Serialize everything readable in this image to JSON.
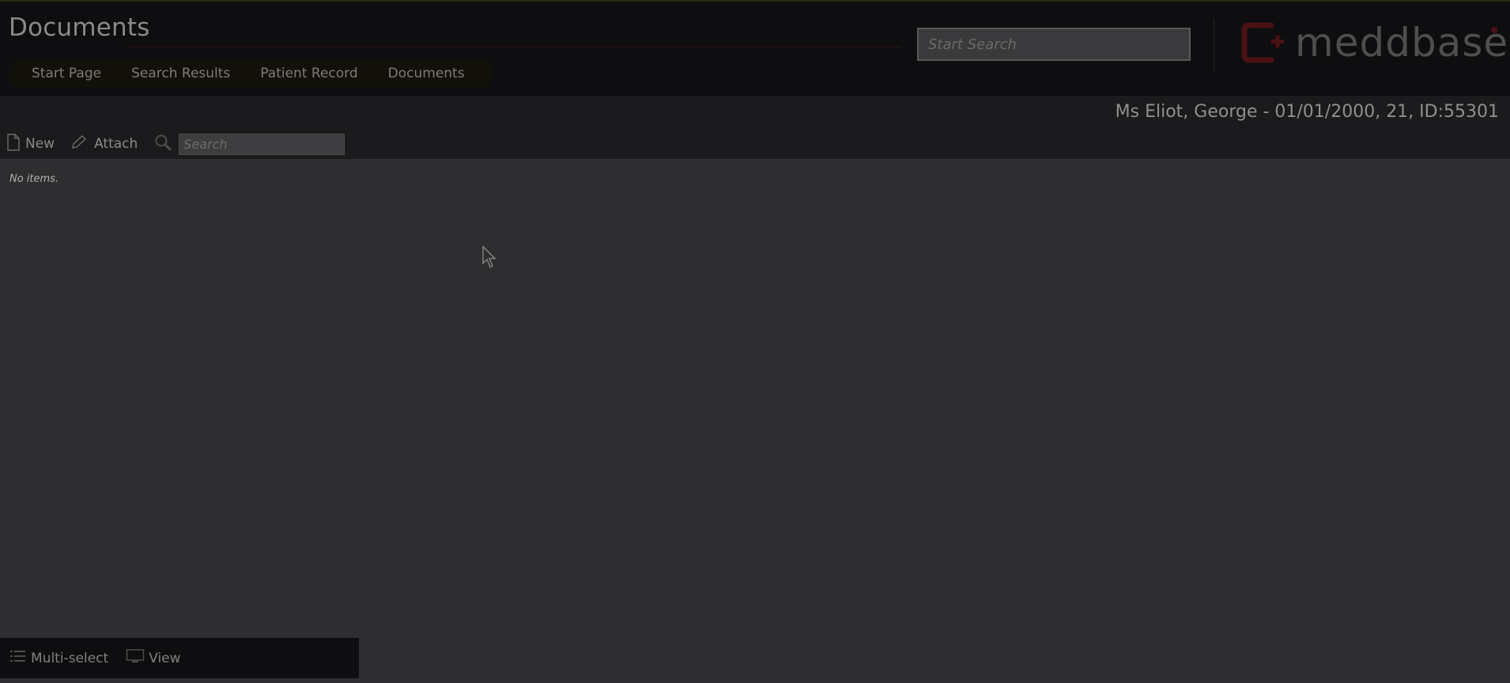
{
  "header": {
    "title": "Documents",
    "breadcrumbs": [
      "Start Page",
      "Search Results",
      "Patient Record",
      "Documents"
    ],
    "search_placeholder": "Start Search",
    "logo_text": "meddbase"
  },
  "patient": {
    "info": "Ms Eliot, George - 01/01/2000, 21, ID:55301"
  },
  "toolbar": {
    "new_label": "New",
    "attach_label": "Attach",
    "search_placeholder": "Search"
  },
  "content": {
    "empty_text": "No items."
  },
  "footer": {
    "multiselect_label": "Multi-select",
    "view_label": "View"
  },
  "colors": {
    "brand_red": "#4a1114",
    "header_bg": "#0e0e10",
    "content_bg": "#2e2e30"
  },
  "icons": [
    "new-document-icon",
    "attach-pencil-icon",
    "magnifier-icon",
    "list-icon",
    "monitor-icon",
    "logo-mark-icon",
    "cursor-arrow-icon"
  ]
}
